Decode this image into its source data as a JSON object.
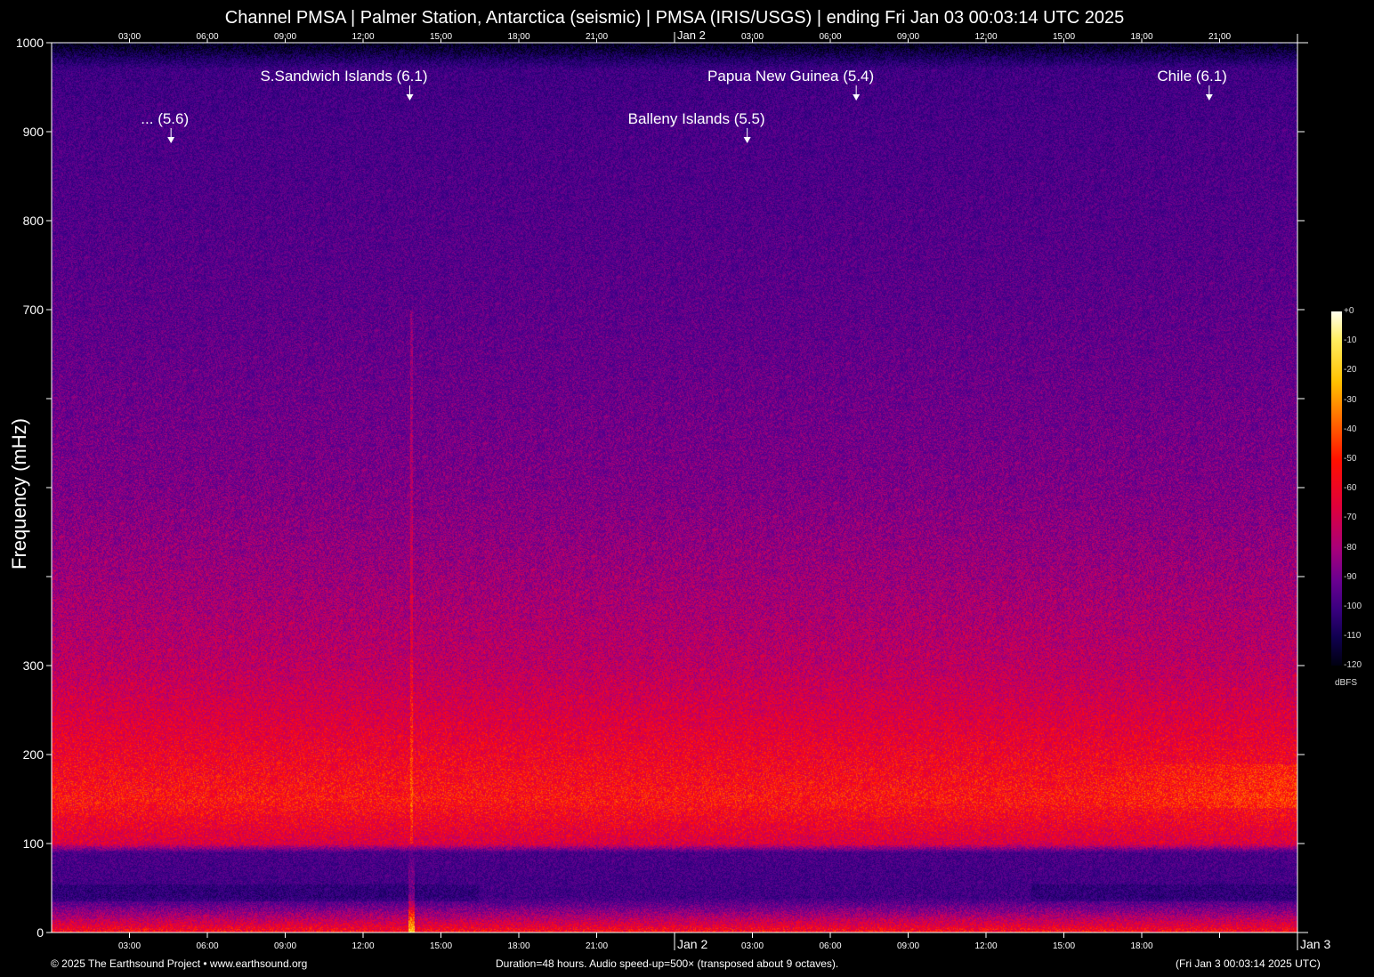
{
  "title": "Channel PMSA | Palmer Station, Antarctica (seismic) | PMSA (IRIS/USGS) | ending Fri Jan 03 00:03:14 UTC 2025",
  "chart_data": {
    "type": "heatmap",
    "title": "Channel PMSA | Palmer Station, Antarctica (seismic) | PMSA (IRIS/USGS) | ending Fri Jan 03 00:03:14 UTC 2025",
    "xlabel": "",
    "ylabel": "Frequency (mHz)",
    "xlim_hours": [
      0,
      48
    ],
    "ylim": [
      0,
      1000
    ],
    "y_ticks": [
      0,
      100,
      200,
      300,
      400,
      500,
      600,
      700,
      800,
      900,
      1000
    ],
    "y_tick_labels": [
      "0",
      "100",
      "200",
      "300",
      "",
      "",
      "",
      "700",
      "800",
      "900",
      "1000"
    ],
    "x_ticks_top": [
      {
        "h": 3,
        "label": "03:00"
      },
      {
        "h": 6,
        "label": "06:00"
      },
      {
        "h": 9,
        "label": "09:00"
      },
      {
        "h": 12,
        "label": "12:00"
      },
      {
        "h": 15,
        "label": "15:00"
      },
      {
        "h": 18,
        "label": "18:00"
      },
      {
        "h": 21,
        "label": "21:00"
      },
      {
        "h": 24,
        "label": "Jan  2"
      },
      {
        "h": 27,
        "label": "03:00"
      },
      {
        "h": 30,
        "label": "06:00"
      },
      {
        "h": 33,
        "label": "09:00"
      },
      {
        "h": 36,
        "label": "12:00"
      },
      {
        "h": 39,
        "label": "15:00"
      },
      {
        "h": 42,
        "label": "18:00"
      },
      {
        "h": 45,
        "label": "21:00"
      }
    ],
    "x_ticks_bottom": [
      {
        "h": 3,
        "label": "03:00"
      },
      {
        "h": 6,
        "label": "06:00"
      },
      {
        "h": 9,
        "label": "09:00"
      },
      {
        "h": 12,
        "label": "12:00"
      },
      {
        "h": 15,
        "label": "15:00"
      },
      {
        "h": 18,
        "label": "18:00"
      },
      {
        "h": 21,
        "label": "21:00"
      },
      {
        "h": 24,
        "label": "Jan  2"
      },
      {
        "h": 27,
        "label": "03:00"
      },
      {
        "h": 30,
        "label": "06:00"
      },
      {
        "h": 33,
        "label": "09:00"
      },
      {
        "h": 36,
        "label": "12:00"
      },
      {
        "h": 39,
        "label": "15:00"
      },
      {
        "h": 42,
        "label": "18:00"
      },
      {
        "h": 45,
        "label": ""
      },
      {
        "h": 48,
        "label": "Jan  3"
      }
    ],
    "events": [
      {
        "label": "... (5.6)",
        "hour": 4.6,
        "row": 2
      },
      {
        "label": "S.Sandwich Islands (6.1)",
        "hour": 13.8,
        "row": 1
      },
      {
        "label": "Balleny Islands (5.5)",
        "hour": 26.8,
        "row": 2
      },
      {
        "label": "Papua New Guinea (5.4)",
        "hour": 31.0,
        "row": 1
      },
      {
        "label": "Chile (6.1)",
        "hour": 44.6,
        "row": 1
      }
    ],
    "colorbar": {
      "unit": "dBFS",
      "ticks": [
        "+0",
        "-10",
        "-20",
        "-30",
        "-40",
        "-50",
        "-60",
        "-70",
        "-80",
        "-90",
        "-100",
        "-110",
        "-120"
      ],
      "range": [
        -120,
        0
      ]
    },
    "level_profile_dbfs": [
      {
        "mHz": 0,
        "db": -50
      },
      {
        "mHz": 40,
        "db": -92
      },
      {
        "mHz": 90,
        "db": -90
      },
      {
        "mHz": 100,
        "db": -60
      },
      {
        "mHz": 150,
        "db": -50
      },
      {
        "mHz": 200,
        "db": -55
      },
      {
        "mHz": 300,
        "db": -66
      },
      {
        "mHz": 500,
        "db": -78
      },
      {
        "mHz": 700,
        "db": -85
      },
      {
        "mHz": 900,
        "db": -90
      },
      {
        "mHz": 970,
        "db": -93
      },
      {
        "mHz": 1000,
        "db": -120
      }
    ]
  },
  "footer": {
    "copyright": "© 2025 The Earthsound Project • www.earthsound.org",
    "duration": "Duration=48 hours. Audio speed-up=500× (transposed about 9 octaves).",
    "timestamp": "(Fri Jan  3 00:03:14 2025 UTC)"
  }
}
